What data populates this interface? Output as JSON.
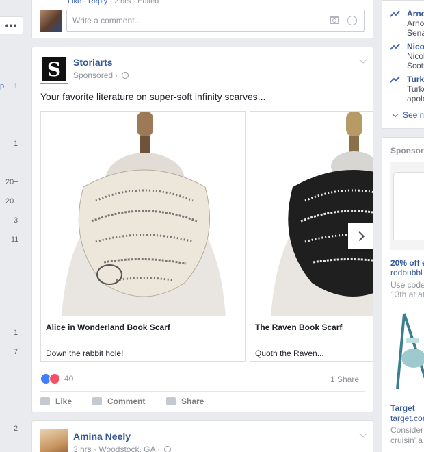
{
  "top_comment": {
    "actions": [
      "Like",
      "Reply",
      "2 hrs",
      "Edited"
    ],
    "input_placeholder": "Write a comment..."
  },
  "left_column": {
    "more_label": "•••",
    "counts": [
      "1",
      "1",
      "20+",
      "20+",
      "3",
      "11",
      "1",
      "7",
      "2"
    ],
    "fragments": [
      "p",
      ".",
      ".",
      ".."
    ]
  },
  "ad_post": {
    "page_name": "Storiarts",
    "logo_letter": "S",
    "sponsored_label": "Sponsored ·",
    "text": "Your favorite literature on super-soft infinity scarves...",
    "carousel": [
      {
        "title": "Alice in Wonderland Book Scarf",
        "description": "Down the rabbit hole!"
      },
      {
        "title": "The Raven Book Scarf",
        "description": "Quoth the Raven..."
      }
    ],
    "reaction_count": "40",
    "share_count": "1 Share",
    "actions": {
      "like": "Like",
      "comment": "Comment",
      "share": "Share"
    }
  },
  "next_post": {
    "author": "Amina Neely",
    "meta": "3 hrs · Woodstock, GA ·"
  },
  "trending": {
    "items": [
      {
        "title": "Arno",
        "lines": [
          "Arno",
          "Sena"
        ]
      },
      {
        "title": "Nico",
        "lines": [
          "Nicol",
          "Scott"
        ]
      },
      {
        "title": "Turke",
        "lines": [
          "Turke",
          "apolo"
        ]
      }
    ],
    "see_more": "See m"
  },
  "sponsored_right": {
    "header": "Sponsore",
    "ad1": {
      "headline": "20% off e",
      "domain": "redbubbl",
      "body1": "Use code",
      "body2": "13th at at"
    },
    "ad2": {
      "headline": "Target",
      "domain": "target.cor",
      "body1": "Consider",
      "body2": "cruisin' a"
    }
  },
  "colors": {
    "link_blue": "#365899",
    "like_blue": "#4080ff",
    "love_red": "#f25268",
    "page_bg": "#e9ebee"
  }
}
